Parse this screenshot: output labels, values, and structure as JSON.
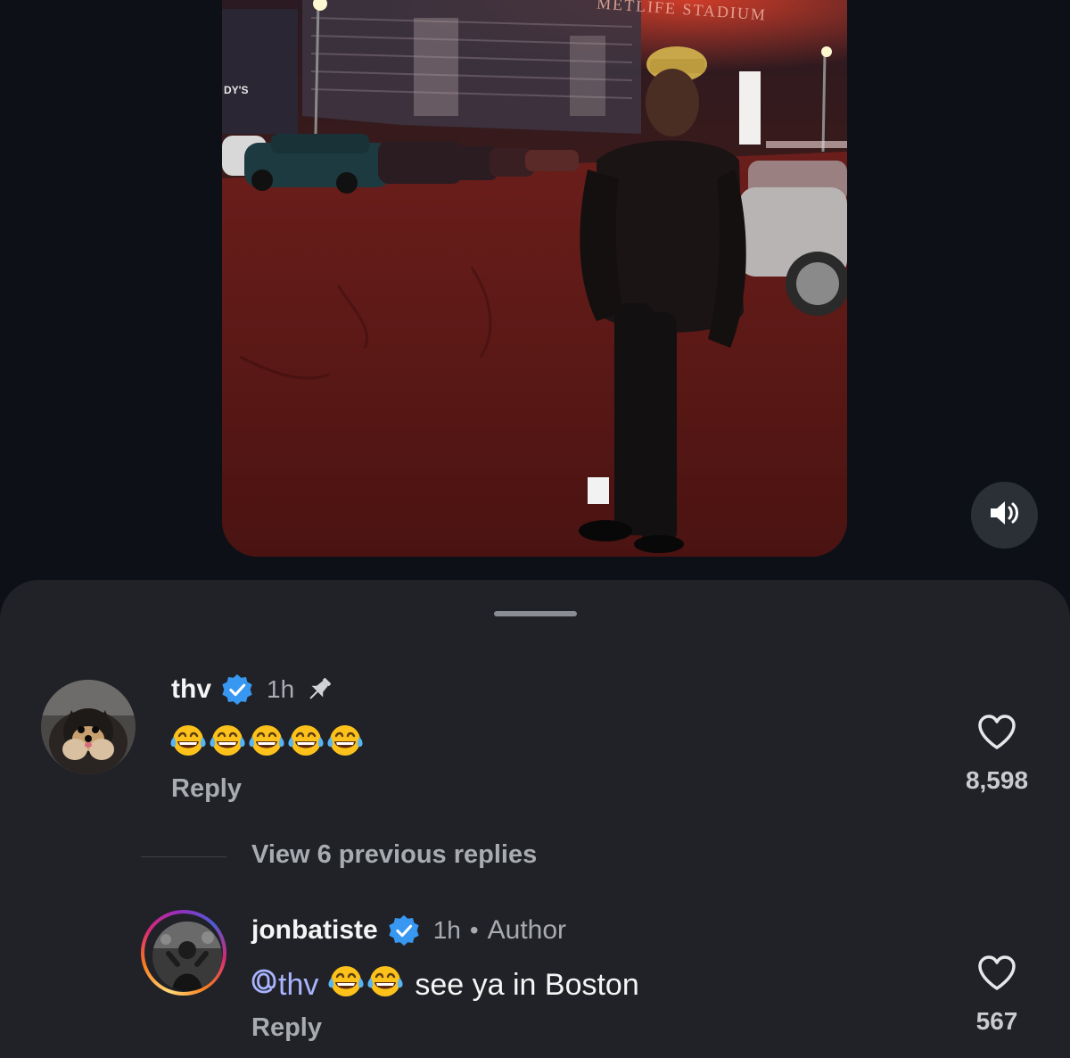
{
  "video": {
    "stadium_sign": "METLIFE STADIUM",
    "store_sign": "DY'S",
    "sound_button": "volume-icon"
  },
  "sheet": {
    "comments": [
      {
        "username": "thv",
        "verified": true,
        "time": "1h",
        "pinned": true,
        "text_emoji_count": 5,
        "text_emoji": "laugh-tears-emoji",
        "reply_label": "Reply",
        "likes": "8,598"
      }
    ],
    "view_replies_label": "View 6 previous replies",
    "replies": [
      {
        "username": "jonbatiste",
        "verified": true,
        "time": "1h",
        "separator": "•",
        "author_label": "Author",
        "mention": "thv",
        "text_emoji_count": 2,
        "text": "see ya in Boston",
        "reply_label": "Reply",
        "likes": "567"
      }
    ]
  },
  "colors": {
    "background": "#0d1117",
    "sheet": "#202228",
    "mention": "#a9b4ff",
    "verified": "#3897f0",
    "muted": "#a8abb0"
  }
}
